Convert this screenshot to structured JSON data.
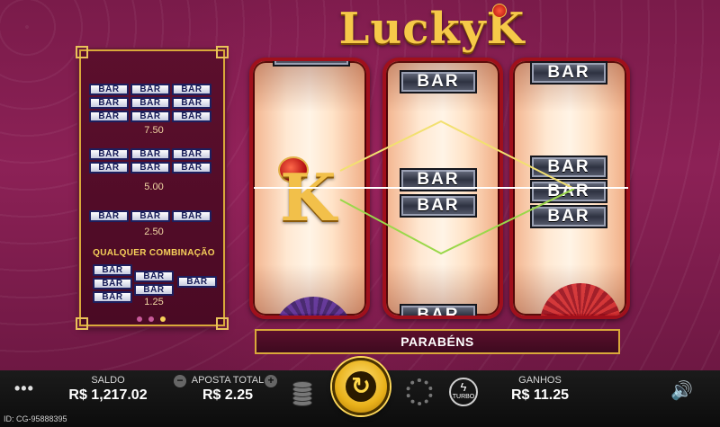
{
  "logo": {
    "text": "LuckyK"
  },
  "paytable": {
    "bar_label": "BAR",
    "rows": [
      {
        "id": "triple",
        "value": "7.50"
      },
      {
        "id": "double",
        "value": "5.00"
      },
      {
        "id": "single",
        "value": "2.50"
      },
      {
        "id": "any",
        "title": "QUALQUER COMBINAÇÃO",
        "value": "1.25"
      }
    ],
    "page_dots": {
      "count": 3,
      "active_index": 2,
      "colors": [
        "#c85a9a",
        "#c85a9a",
        "#f6d05a"
      ]
    }
  },
  "reels": {
    "bar_label": "BAR",
    "reel_1": {
      "center_symbol": "Lucky K"
    },
    "reel_2": {
      "symbols": [
        "BAR",
        "BAR",
        "BAR",
        "BAR"
      ]
    },
    "reel_3": {
      "symbols": [
        "BAR",
        "BAR",
        "BAR",
        "BAR"
      ]
    }
  },
  "paylines": {
    "colors": [
      "#f2e070",
      "#9ad84a",
      "#ffffff"
    ]
  },
  "win_banner": {
    "text": "PARABÉNS"
  },
  "footer": {
    "menu_icon": "menu-dots-icon",
    "saldo_label": "SALDO",
    "saldo_value": "R$ 1,217.02",
    "bet_label": "APOSTA TOTAL",
    "bet_value": "R$ 2.25",
    "bet_minus": "−",
    "bet_plus": "+",
    "spin_icon": "↻",
    "turbo_label": "TURBO",
    "turbo_icon": "ϟ",
    "ganhos_label": "GANHOS",
    "ganhos_value": "R$ 11.25",
    "sound_icon": "🔊",
    "id_text": "ID: CG-95888395"
  }
}
